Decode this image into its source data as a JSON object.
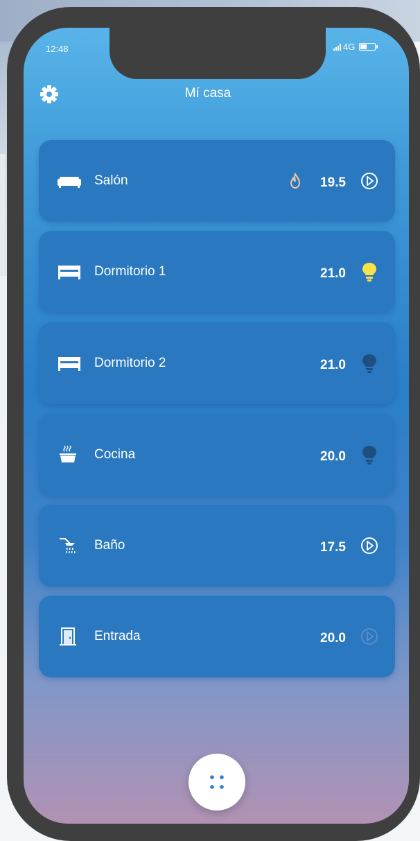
{
  "status_bar": {
    "time": "12:48",
    "network": "4G"
  },
  "header": {
    "title": "Mí casa",
    "settings_icon": "gear-icon"
  },
  "rooms": [
    {
      "name": "Salón",
      "temp": "19.5",
      "room_icon": "sofa-icon",
      "heating": true,
      "end_icon": "play-circle-icon"
    },
    {
      "name": "Dormitorio 1",
      "temp": "21.0",
      "room_icon": "bed-icon",
      "end_icon": "bulb-on-icon"
    },
    {
      "name": "Dormitorio 2",
      "temp": "21.0",
      "room_icon": "bed-icon",
      "end_icon": "bulb-off-icon"
    },
    {
      "name": "Cocina",
      "temp": "20.0",
      "room_icon": "pot-icon",
      "end_icon": "bulb-off-icon"
    },
    {
      "name": "Baño",
      "temp": "17.5",
      "room_icon": "shower-icon",
      "end_icon": "play-circle-icon"
    },
    {
      "name": "Entrada",
      "temp": "20.0",
      "room_icon": "door-icon",
      "end_icon": "play-circle-icon-dim"
    }
  ],
  "colors": {
    "bulb_on": "#f7e24a",
    "bulb_off": "#1f4f80",
    "flame": "#f4c7a6",
    "card": "#2a78bf"
  },
  "fab": {
    "icon": "dots-grid-icon"
  }
}
